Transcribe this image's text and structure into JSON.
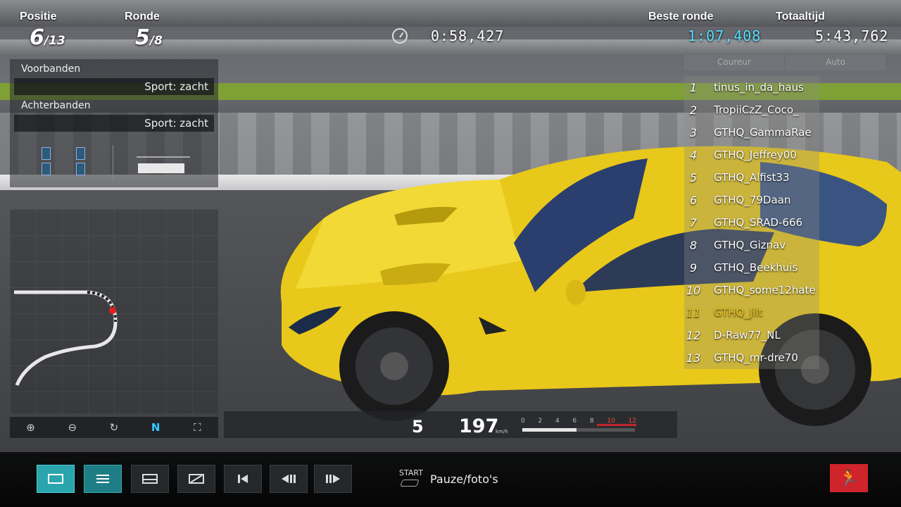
{
  "hud": {
    "position_label": "Positie",
    "position_value": "6",
    "position_total": "/13",
    "lap_label": "Ronde",
    "lap_value": "5",
    "lap_total": "/8",
    "current_lap_time": "0:58,427",
    "best_lap_label": "Beste ronde",
    "best_lap_time": "1:07,408",
    "total_time_label": "Totaaltijd",
    "total_time": "5:43,762"
  },
  "tyres": {
    "front_label": "Voorbanden",
    "front_value": "Sport: zacht",
    "rear_label": "Achterbanden",
    "rear_value": "Sport: zacht"
  },
  "map_toolbar": {
    "zoom_in": "⊕",
    "zoom_out": "⊖",
    "rotate": "↻",
    "north": "N",
    "fit": "⛶"
  },
  "leaderboard": {
    "tab_driver": "Coureur",
    "tab_car": "Auto",
    "rows": [
      {
        "pos": "1",
        "name": "tinus_in_da_haus"
      },
      {
        "pos": "2",
        "name": "TropiiCzZ_Coco_"
      },
      {
        "pos": "3",
        "name": "GTHQ_GammaRae"
      },
      {
        "pos": "4",
        "name": "GTHQ_Jeffrey00"
      },
      {
        "pos": "5",
        "name": "GTHQ_Alfist33"
      },
      {
        "pos": "6",
        "name": "GTHQ_79Daan"
      },
      {
        "pos": "7",
        "name": "GTHQ_SRAD-666"
      },
      {
        "pos": "8",
        "name": "GTHQ_Giznav"
      },
      {
        "pos": "9",
        "name": "GTHQ_Beekhuis"
      },
      {
        "pos": "10",
        "name": "GTHQ_some12hate"
      },
      {
        "pos": "11",
        "name": "GTHQ_Jilt"
      },
      {
        "pos": "12",
        "name": "D-Raw77_NL"
      },
      {
        "pos": "13",
        "name": "GTHQ_mr-dre70"
      }
    ],
    "highlight_pos": "11",
    "highlight_color": "#f0c020"
  },
  "gauge": {
    "gear": "5",
    "speed": "197",
    "unit": "km/h",
    "rpm_ticks": [
      "0",
      "2",
      "4",
      "6",
      "8",
      "10",
      "12"
    ],
    "rpm_redline_from": "10",
    "rpm_level": 0.48
  },
  "bottom_bar": {
    "start_label": "START",
    "pause_label": "Pauze/foto's",
    "active_color": "#2aa5ad",
    "exit_color": "#d0242c"
  }
}
